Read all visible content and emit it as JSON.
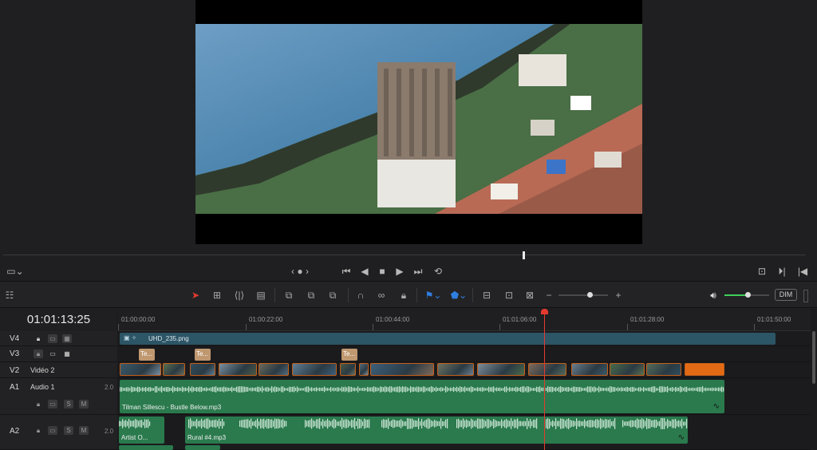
{
  "timeline": {
    "timecode": "01:01:13:25",
    "ruler": [
      "01:00:00:00",
      "01:00:22:00",
      "01:00:44:00",
      "01:01:06:00",
      "01:01:28:00",
      "01:01:50:00"
    ]
  },
  "toolbar": {
    "dim_label": "DIM"
  },
  "transport": {
    "jog": "‹ ● ›"
  },
  "tracks": {
    "v4": {
      "name": "V4",
      "clip": "UHD_235.png"
    },
    "v3": {
      "name": "V3",
      "clips": [
        "Te...",
        "Te...",
        "Te..."
      ]
    },
    "v2": {
      "name": "V2",
      "label": "Vidéo 2"
    },
    "a1": {
      "name": "A1",
      "label": "Audio 1",
      "channels": "2.0",
      "clip": "Tilman Sillescu - Bustle Below.mp3",
      "solo": "S",
      "mute": "M"
    },
    "a2": {
      "name": "A2",
      "channels": "2.0",
      "clips": [
        "Artist O...",
        "Rural #4.mp3"
      ],
      "solo": "S",
      "mute": "M"
    }
  },
  "colors": {
    "playhead": "#e53a30",
    "audio_clip": "#2a7a4d",
    "video_clip": "#2c5566",
    "title_clip": "#c09870",
    "thumb_border": "#c25f1a"
  },
  "icons": [
    "selection-arrow-icon",
    "blade-icon",
    "snap-icon",
    "link-icon",
    "lock-icon",
    "flag-icon",
    "marker-icon",
    "zoom-icon",
    "volume-icon"
  ]
}
